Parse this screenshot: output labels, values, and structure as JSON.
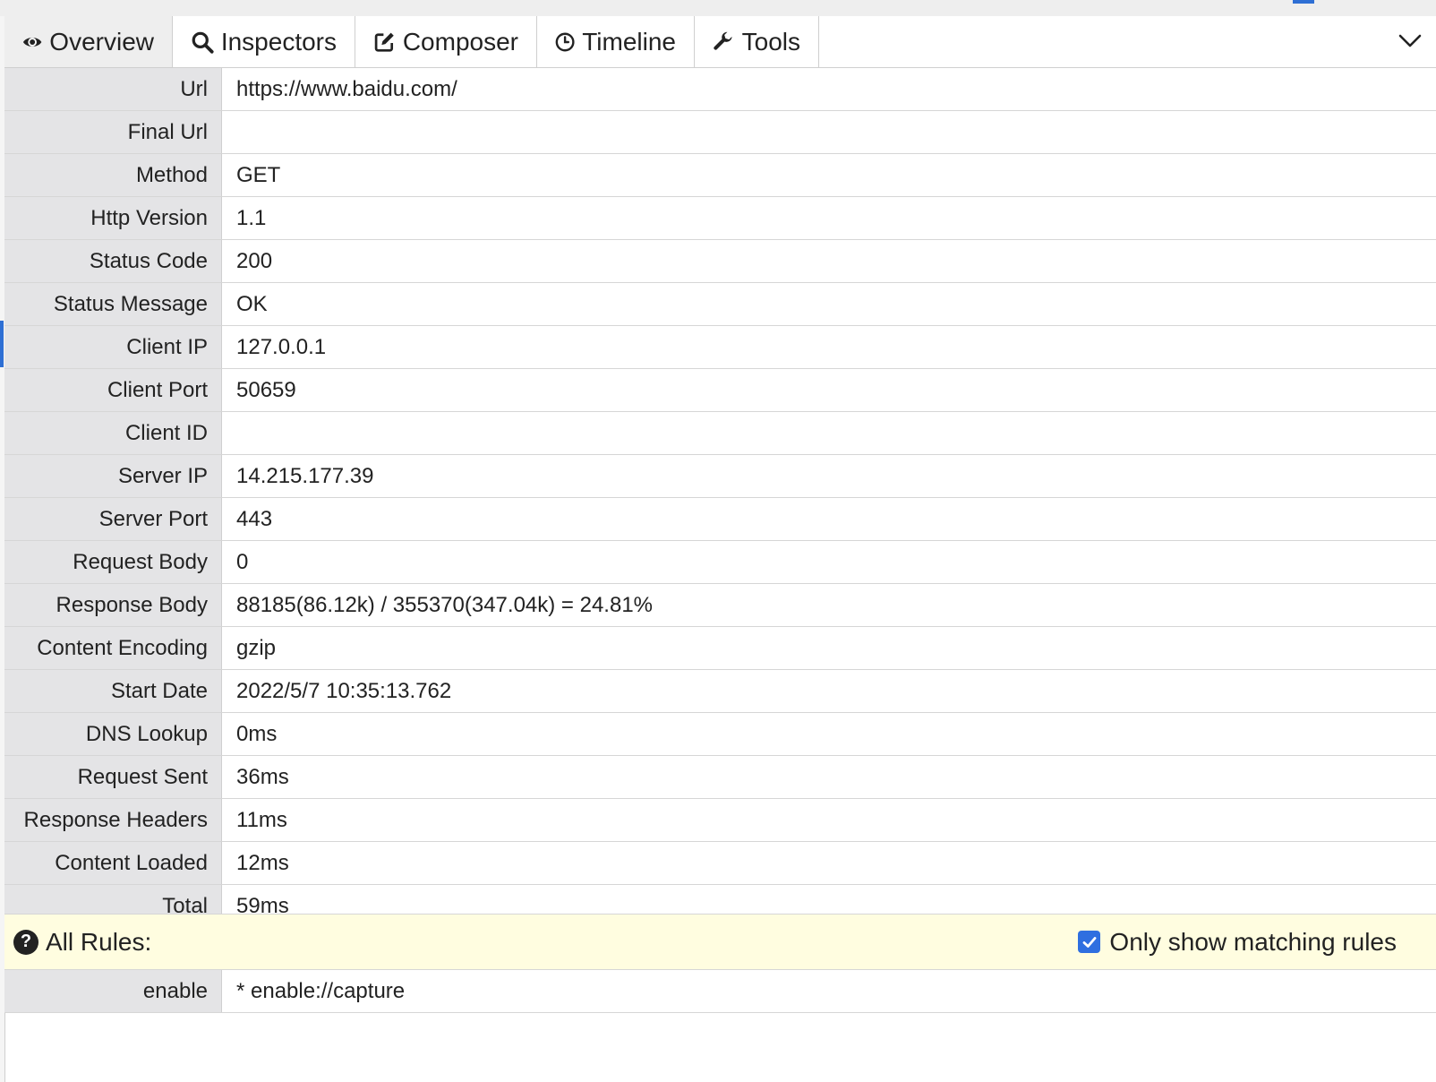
{
  "tabs": [
    {
      "label": "Overview",
      "icon": "eye-icon"
    },
    {
      "label": "Inspectors",
      "icon": "search-icon"
    },
    {
      "label": "Composer",
      "icon": "edit-icon"
    },
    {
      "label": "Timeline",
      "icon": "clock-icon"
    },
    {
      "label": "Tools",
      "icon": "wrench-icon"
    }
  ],
  "overview": {
    "rows": [
      {
        "label": "Url",
        "value": "https://www.baidu.com/"
      },
      {
        "label": "Final Url",
        "value": ""
      },
      {
        "label": "Method",
        "value": "GET"
      },
      {
        "label": "Http Version",
        "value": "1.1"
      },
      {
        "label": "Status Code",
        "value": "200"
      },
      {
        "label": "Status Message",
        "value": "OK"
      },
      {
        "label": "Client IP",
        "value": "127.0.0.1"
      },
      {
        "label": "Client Port",
        "value": "50659"
      },
      {
        "label": "Client ID",
        "value": ""
      },
      {
        "label": "Server IP",
        "value": "14.215.177.39"
      },
      {
        "label": "Server Port",
        "value": "443"
      },
      {
        "label": "Request Body",
        "value": "0"
      },
      {
        "label": "Response Body",
        "value": "88185(86.12k) / 355370(347.04k) = 24.81%"
      },
      {
        "label": "Content Encoding",
        "value": "gzip"
      },
      {
        "label": "Start Date",
        "value": "2022/5/7 10:35:13.762"
      },
      {
        "label": "DNS Lookup",
        "value": "0ms"
      },
      {
        "label": "Request Sent",
        "value": "36ms"
      },
      {
        "label": "Response Headers",
        "value": "11ms"
      },
      {
        "label": "Content Loaded",
        "value": "12ms"
      },
      {
        "label": "Total",
        "value": "59ms"
      }
    ]
  },
  "rules": {
    "title": "All Rules:",
    "help_icon": "question-circle-icon",
    "filter_label": "Only show matching rules",
    "filter_checked": true,
    "items": [
      {
        "label": "enable",
        "value": "* enable://capture"
      }
    ]
  },
  "colors": {
    "accent": "#2f6fe0",
    "label_bg": "#e4e4e6",
    "rules_bar_bg": "#fffde0",
    "active_tab_bg": "#eeeeee"
  }
}
